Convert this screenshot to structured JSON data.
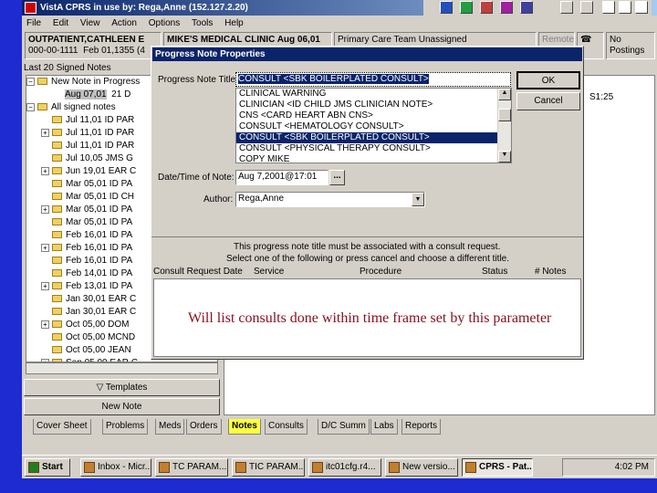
{
  "window": {
    "title": "VistA CPRS in use by: Rega,Anne  (152.127.2.20)"
  },
  "menu": [
    "File",
    "Edit",
    "View",
    "Action",
    "Options",
    "Tools",
    "Help"
  ],
  "header": {
    "patient_name": "OUTPATIENT,CATHLEEN E",
    "patient_id": "000-00-1111",
    "patient_dob": "Feb 01,1355 (4",
    "clinic": "MIKE'S MEDICAL CLINIC Aug 06,01",
    "care_team": "Primary Care Team Unassigned",
    "remote": "Remote",
    "postings": "No Postings"
  },
  "notes_panel": {
    "header": "Last 20 Signed Notes",
    "new_note_in_progress": "New Note in Progress",
    "new_note_date": "Aug 07,01",
    "new_note_time": "21 D",
    "all_signed": "All signed notes",
    "rows": [
      "Jul 11,01  ID PAR",
      "Jul 11,01  ID PAR",
      "Jul 11,01  ID PAR",
      "Jul 10,05  JMS G",
      "Jun 19,01  EAR C",
      "Mar 05,01  ID PA",
      "Mar 05,01  ID CH",
      "Mar 05,01  ID PA",
      "Mar 05,01  ID PA",
      "Feb 16,01  ID PA",
      "Feb 16,01  ID PA",
      "Feb 16,01  ID PA",
      "Feb 14,01  ID PA",
      "Feb 13,01  ID PA",
      "Jan 30,01  EAR C",
      "Jan 30,01  EAR C",
      "Oct 05,00  DOM",
      "Oct 05,00  MCND",
      "Oct 05,00  JEAN",
      "Sep 05,00  EAR C"
    ],
    "templates": "Templates",
    "new_note": "New Note"
  },
  "right_fragment": "S1:25",
  "dialog": {
    "title": "Progress Note Properties",
    "title_label": "Progress Note Title:",
    "title_value": "CONSULT  <SBK BOILERPLATED CONSULT>",
    "options": [
      "CLINICAL WARNING",
      "CLINICIAN  <ID CHILD JMS CLINICIAN NOTE>",
      "CNS  <CARD HEART ABN CNS>",
      "CONSULT  <HEMATOLOGY CONSULT>",
      "CONSULT  <SBK BOILERPLATED CONSULT>",
      "CONSULT  <PHYSICAL THERAPY CONSULT>",
      "COPY MIKE"
    ],
    "selected_index": 4,
    "date_label": "Date/Time of Note:",
    "date_value": "Aug 7,2001@17:01",
    "author_label": "Author:",
    "author_value": "Rega,Anne",
    "ok": "OK",
    "cancel": "Cancel",
    "ellipsis": "...",
    "msg_line1": "This progress note title must be associated with a consult request.",
    "msg_line2": "Select one of the following or press cancel and choose a different title.",
    "columns": [
      "Consult Request Date",
      "Service",
      "Procedure",
      "Status",
      "# Notes"
    ],
    "annotation": "Will list consults done within time frame set by this parameter"
  },
  "tabs": [
    "Cover Sheet",
    "Problems",
    "Meds",
    "Orders",
    "Notes",
    "Consults",
    "D/C Summ",
    "Labs",
    "Reports"
  ],
  "active_tab": "Notes",
  "taskbar": {
    "start": "Start",
    "tasks": [
      "Inbox - Micr...",
      "TC PARAM...",
      "TIC PARAM...",
      "itc01cfg.r4...",
      "New versio...",
      "CPRS - Pat..."
    ],
    "clock": "4:02 PM"
  }
}
